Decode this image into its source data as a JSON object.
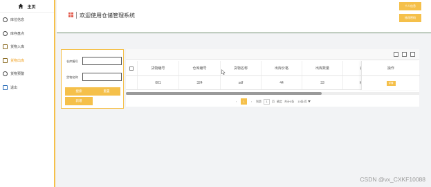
{
  "sidebar": {
    "home_label": "主页",
    "items": [
      {
        "label": "库位信息",
        "icon": "clock-icon"
      },
      {
        "label": "库存盘点",
        "icon": "clock-icon"
      },
      {
        "label": "货物入库",
        "icon": "file-icon"
      },
      {
        "label": "货物出库",
        "icon": "file-icon",
        "active": true
      },
      {
        "label": "货物预警",
        "icon": "clock-icon"
      },
      {
        "label": "退出",
        "icon": "square-icon"
      }
    ]
  },
  "header": {
    "title": "欢迎使用仓储管理系统",
    "user_buttons": [
      "个人信息",
      "修改密码"
    ]
  },
  "search": {
    "warehouse_label": "仓库编号",
    "warehouse_value": "",
    "goods_label": "货物名称",
    "goods_value": "",
    "search_button": "搜索",
    "reset_button": "重置",
    "add_button": "新增"
  },
  "table": {
    "headers": [
      "货物编号",
      "仓库编号",
      "货物名称",
      "出库价格",
      "出库数量",
      "备注"
    ],
    "action_header": "操作",
    "rows": [
      {
        "cells": [
          "001",
          "324",
          "sdf",
          "44",
          "33",
          "fg hg"
        ],
        "action": "详情"
      }
    ]
  },
  "pagination": {
    "prev": "‹",
    "current_page": "1",
    "next": "›",
    "goto_label": "到第",
    "goto_value": "1",
    "page_unit": "页",
    "confirm": "确定",
    "total": "共计0条",
    "page_size": "10条/页"
  },
  "colors": {
    "accent": "#f5c04a",
    "danger_logo": "#e35d4f",
    "background": "#f2f3f5"
  },
  "watermark": "CSDN @vx_CXKF10088"
}
